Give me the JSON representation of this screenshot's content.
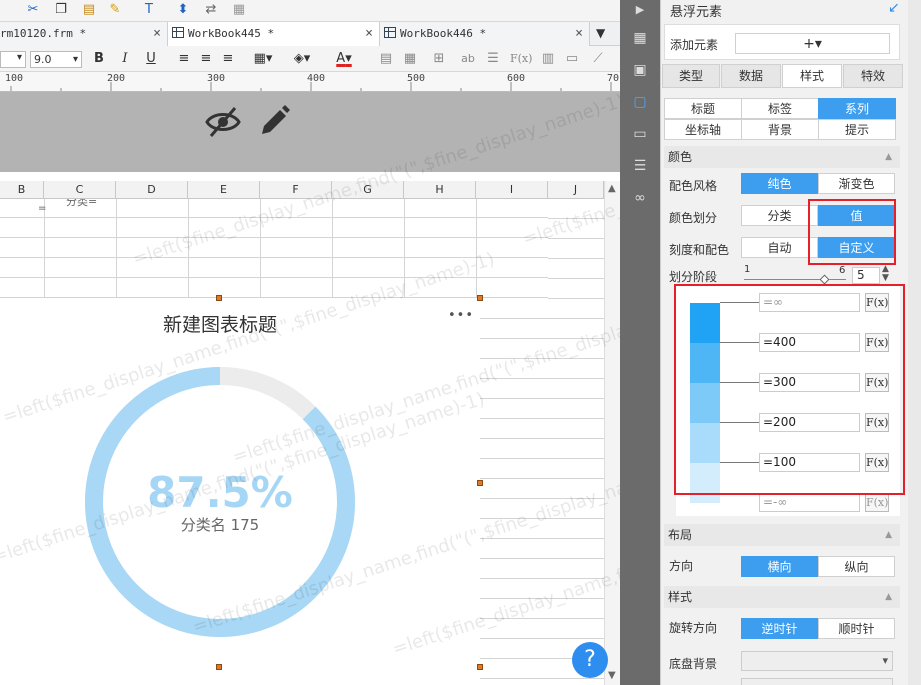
{
  "toolbar_icons": [
    "cut-icon",
    "copy-icon",
    "paste-icon",
    "format-painter-icon",
    "text-icon",
    "save-icon",
    "share-icon",
    "undo-icon"
  ],
  "tabs": [
    {
      "label": "rm10120.frm *",
      "close": "×"
    },
    {
      "label": "WorkBook445 *",
      "close": "×"
    },
    {
      "label": "WorkBook446 *",
      "close": "×"
    }
  ],
  "tabs_menu_icon": "dropdown-icon",
  "format_bar": {
    "font_size": "9.0",
    "bold": "B",
    "italic": "I",
    "underline": "U",
    "fx": "F(x)",
    "text_color": "A",
    "text_icon": "ab"
  },
  "ruler": {
    "marks": [
      "100",
      "200",
      "300",
      "400",
      "500",
      "600",
      "70"
    ]
  },
  "gray_band_icons": [
    "eye-hidden-icon",
    "pencil-icon"
  ],
  "columns": [
    "B",
    "C",
    "D",
    "E",
    "F",
    "G",
    "H",
    "I",
    "J"
  ],
  "cell_fragment": "分类=",
  "chart": {
    "title": "新建图表标题",
    "more": "•••",
    "percent_label": "87.5%",
    "sub_label": "分类名 175",
    "value_percent": 87.5,
    "ring_fill_color": "#a8d8f5",
    "ring_track_color": "#ececec",
    "label_color": "#a6d6f6"
  },
  "watermark_text": "=left($fine_display_name,find(\"(\",$fine_display_name)-1)",
  "help_button": "?",
  "side_icons": [
    "play-icon",
    "table-icon",
    "template-icon",
    "float-element-icon",
    "widget-icon",
    "layer-icon",
    "link-icon"
  ],
  "panel": {
    "title": "悬浮元素",
    "title_icon": "collapse-arrow-icon",
    "add_label": "添加元素",
    "add_button": "+▾",
    "tabs": [
      "类型",
      "数据",
      "样式",
      "特效"
    ],
    "active_tab": "样式",
    "subtabs_row1": [
      "标题",
      "标签",
      "系列"
    ],
    "subtabs_row2": [
      "坐标轴",
      "背景",
      "提示"
    ],
    "active_subtab": "系列",
    "color_section": "颜色",
    "scheme_label": "配色风格",
    "scheme_options": [
      "纯色",
      "渐变色"
    ],
    "scheme_active": "纯色",
    "divide_label": "颜色划分",
    "divide_options": [
      "分类",
      "值"
    ],
    "divide_active": "值",
    "scale_label": "刻度和配色",
    "scale_options": [
      "自动",
      "自定义"
    ],
    "scale_active": "自定义",
    "stage_label": "划分阶段",
    "stage_min": "1",
    "stage_max": "6",
    "stage_value": "5",
    "ranges": [
      {
        "value": "=∞",
        "color": "#21a3f5",
        "fx": "F(x)"
      },
      {
        "value": "=400",
        "color": "#4fb6f6",
        "fx": "F(x)"
      },
      {
        "value": "=300",
        "color": "#7dc9f8",
        "fx": "F(x)"
      },
      {
        "value": "=200",
        "color": "#a9dbfa",
        "fx": "F(x)"
      },
      {
        "value": "=100",
        "color": "#d4edfc",
        "fx": "F(x)"
      }
    ],
    "range_last": "=-∞",
    "layout_section": "布局",
    "direction_label": "方向",
    "direction_options": [
      "横向",
      "纵向"
    ],
    "direction_active": "横向",
    "style_section": "样式",
    "rotate_label": "旋转方向",
    "rotate_options": [
      "逆时针",
      "顺时针"
    ],
    "rotate_active": "逆时针",
    "bg_label": "底盘背景"
  }
}
